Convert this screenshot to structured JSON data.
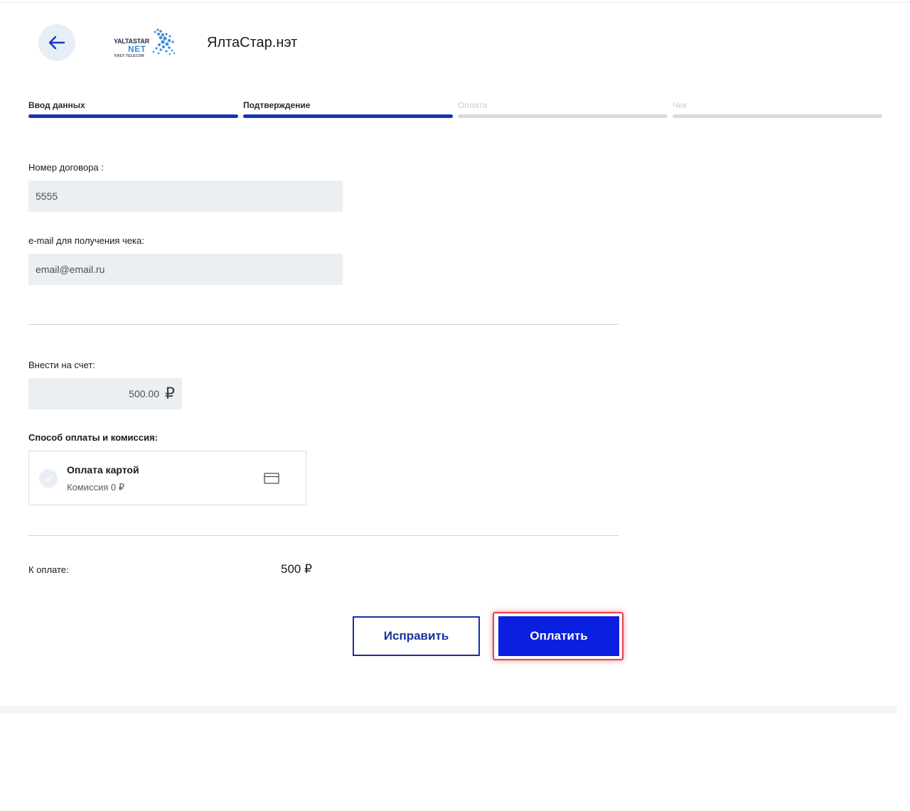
{
  "header": {
    "merchant_name": "ЯлтаСтар.нэт",
    "logo": {
      "line1": "YALTASTAR",
      "line2": "NET",
      "line3": "KNET-TELECOM"
    }
  },
  "steps": [
    {
      "label": "Ввод данных",
      "state": "done"
    },
    {
      "label": "Подтверждение",
      "state": "current"
    },
    {
      "label": "Оплата",
      "state": "pending"
    },
    {
      "label": "Чек",
      "state": "pending"
    }
  ],
  "form": {
    "contract": {
      "label": "Номер договора :",
      "value": "5555"
    },
    "email": {
      "label": "e-mail для получения чека:",
      "value": "email@email.ru"
    },
    "amount": {
      "label": "Внести на счет:",
      "value": "500.00",
      "currency_symbol": "₽"
    },
    "payment_method": {
      "label": "Способ оплаты и комиссия:",
      "option_title": "Оплата картой",
      "option_fee": "Комиссия 0 ₽"
    }
  },
  "total": {
    "label": "К оплате:",
    "value": "500 ₽"
  },
  "actions": {
    "edit_label": "Исправить",
    "pay_label": "Оплатить"
  },
  "colors": {
    "accent": "#0a1fe0",
    "progress": "#1531b8",
    "highlight": "#e3434b"
  }
}
